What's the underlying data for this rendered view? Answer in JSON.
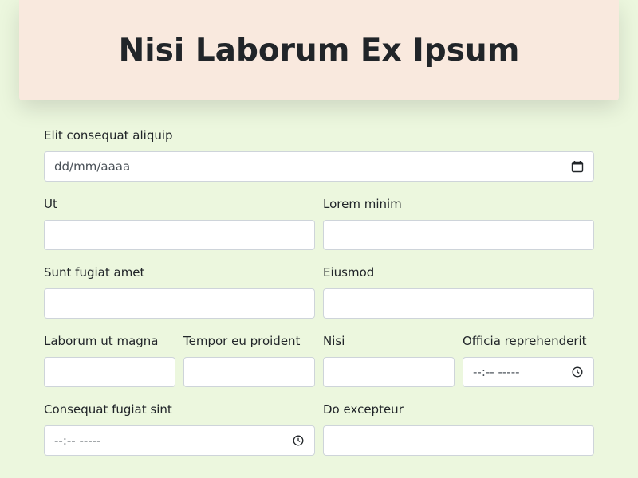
{
  "header": {
    "title": "Nisi Laborum Ex Ipsum"
  },
  "form": {
    "date_field": {
      "label": "Elit consequat aliquip",
      "placeholder": "dd/mm/aaaa"
    },
    "ut": {
      "label": "Ut",
      "value": ""
    },
    "lorem_minim": {
      "label": "Lorem minim",
      "value": ""
    },
    "sunt_fugiat_amet": {
      "label": "Sunt fugiat amet",
      "value": ""
    },
    "eiusmod": {
      "label": "Eiusmod",
      "value": ""
    },
    "laborum_ut_magna": {
      "label": "Laborum ut magna",
      "value": ""
    },
    "tempor_eu_proident": {
      "label": "Tempor eu proident",
      "value": ""
    },
    "nisi": {
      "label": "Nisi",
      "value": ""
    },
    "officia_reprehenderit": {
      "label": "Officia reprehenderit",
      "placeholder": "--:-- -----"
    },
    "consequat_fugiat_sint": {
      "label": "Consequat fugiat sint",
      "placeholder": "--:-- -----"
    },
    "do_excepteur": {
      "label": "Do excepteur",
      "value": ""
    }
  },
  "icons": {
    "calendar": "calendar-icon",
    "clock": "clock-icon"
  }
}
